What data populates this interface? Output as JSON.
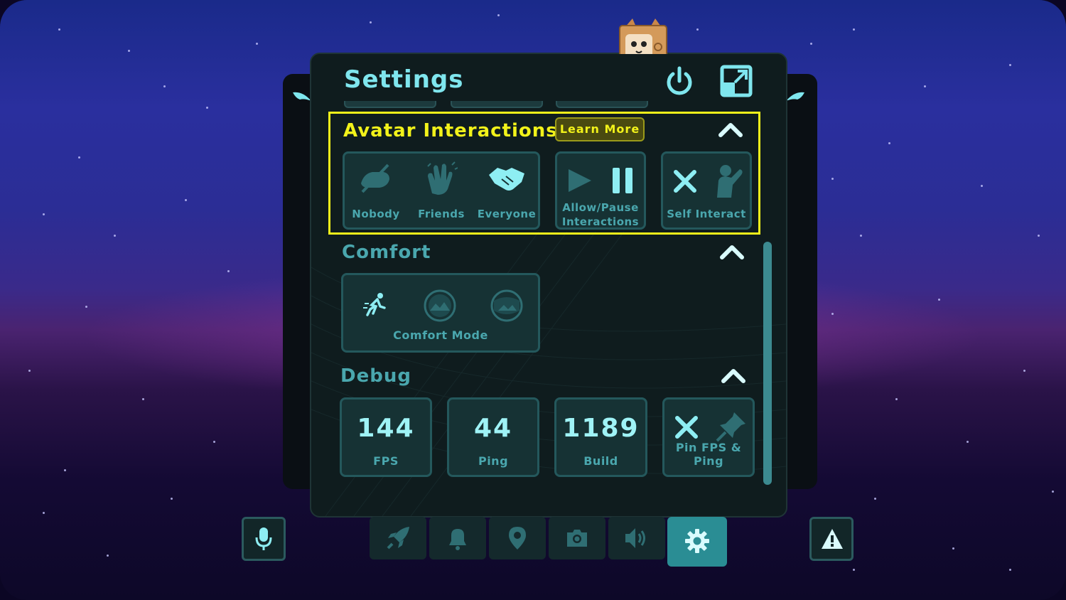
{
  "panel": {
    "title": "Settings"
  },
  "avatar_interactions": {
    "title": "Avatar Interactions",
    "learn_more": "Learn More",
    "options": [
      "Nobody",
      "Friends",
      "Everyone"
    ],
    "allow_pause_line1": "Allow/Pause",
    "allow_pause_line2": "Interactions",
    "self_interact": "Self Interact"
  },
  "comfort": {
    "title": "Comfort",
    "mode_label": "Comfort Mode"
  },
  "debug": {
    "title": "Debug",
    "fps": {
      "value": "144",
      "label": "FPS"
    },
    "ping": {
      "value": "44",
      "label": "Ping"
    },
    "build": {
      "value": "1189",
      "label": "Build"
    },
    "pin_label": "Pin FPS & Ping"
  },
  "dock": {
    "items": [
      "rocket-icon",
      "bell-icon",
      "map-pin-icon",
      "camera-icon",
      "speaker-icon",
      "gear-icon"
    ],
    "active": "gear-icon"
  },
  "colors": {
    "accent": "#7fe6ee",
    "highlight": "#f2f21a",
    "panel_bg": "#0f1c1e",
    "card_bg": "#163234"
  }
}
